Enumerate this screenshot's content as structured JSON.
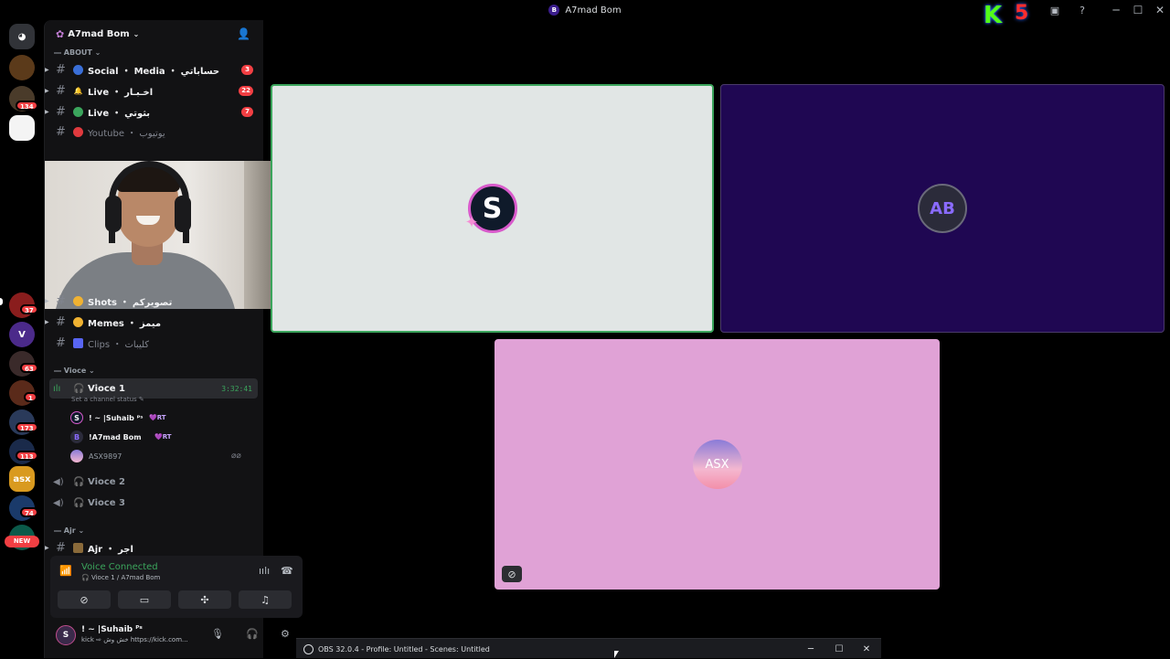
{
  "window": {
    "title": "A7mad Bom",
    "server_initial": "B",
    "overlay_letter": "K",
    "overlay_number": "5"
  },
  "rail": {
    "badges": [
      "134",
      "37",
      "63",
      "1",
      "173",
      "113",
      "74"
    ],
    "new_label": "NEW"
  },
  "sidebar": {
    "server_name": "A7mad Bom",
    "categories": {
      "about": "ABOUT",
      "voice": "Vioce",
      "ajr": "Ajr"
    },
    "channels": [
      {
        "name": "Social ・ Media ・ حساباتي",
        "count": "3"
      },
      {
        "name": "Live ・ اخـبـار",
        "count": "22"
      },
      {
        "name": "Live ・ بثوتي",
        "count": "7"
      },
      {
        "name": "Youtube ・ يوتيوب",
        "count": ""
      },
      {
        "name": "Shots ・ تصويركم",
        "count": ""
      },
      {
        "name": "Memes ・ ميمز",
        "count": ""
      },
      {
        "name": "Clips ・ كليبات",
        "count": ""
      },
      {
        "name": "Ajr ・ اجر",
        "count": ""
      }
    ],
    "voice": {
      "active_name": "Vioce 1",
      "timer": "3:32:41",
      "status_hint": "Set a channel status",
      "members": [
        {
          "initial": "S",
          "name": "! ~ |Suhaib ᴾˢ",
          "tag": "RT"
        },
        {
          "initial": "B",
          "name": "!A7mad Bom",
          "tag": "RT"
        },
        {
          "initial": "",
          "name": "ASX9897",
          "tag": ""
        }
      ],
      "other_channels": [
        "Vioce 2",
        "Vioce 3"
      ]
    }
  },
  "voice_panel": {
    "status": "Voice Connected",
    "location": "Vioce 1 / A7mad Bom"
  },
  "user_panel": {
    "name": "! ~ |Suhaib ᴾˢ",
    "status": "kick ⇨ خش وش https://kick.com..."
  },
  "stage": {
    "tile_initials": [
      "S",
      "AB",
      "ASX"
    ]
  },
  "taskbar": {
    "obs_title": "OBS 32.0.4 - Profile: Untitled - Scenes: Untitled"
  },
  "colors": {
    "accent_green": "#3ba55c",
    "badge_red": "#f23f43",
    "tile1_bg": "#e1e6e5",
    "tile2_bg": "#1f0752",
    "tile3_bg": "#e0a2d6"
  }
}
